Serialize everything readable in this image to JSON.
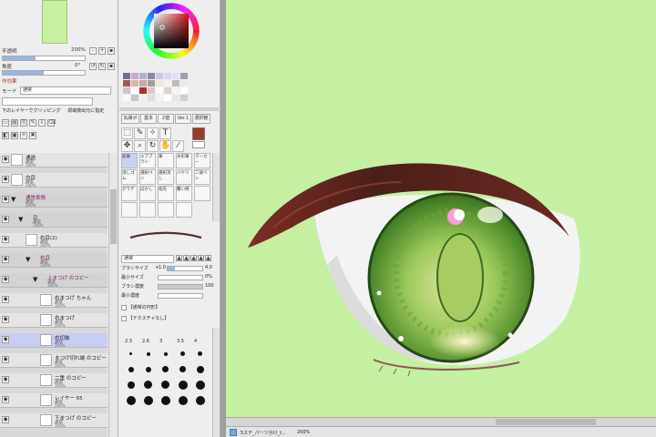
{
  "left_panel": {
    "opacity_label": "不透明",
    "opacity_value": "100%",
    "zoom_value": "200%",
    "rotate_label": "角度",
    "rotate_value": "0°",
    "effects_label": "作効果",
    "texture_label": "テクスチャ",
    "mode_label": "モード",
    "mode_value": "通常",
    "clip_label": "下のレイヤーでクリッピング",
    "select_label": "領域検出元に指定"
  },
  "layers": [
    {
      "name": "通過",
      "mode": "通常",
      "opacity": "100%",
      "type": "layer",
      "indent": 0
    },
    {
      "name": "白目",
      "mode": "通常",
      "opacity": "100%",
      "type": "layer",
      "indent": 0
    },
    {
      "name": "通常表情",
      "mode": "通常",
      "opacity": "100%",
      "type": "group",
      "indent": 0
    },
    {
      "name": "目",
      "mode": "通常",
      "opacity": "100%",
      "type": "group",
      "indent": 1
    },
    {
      "name": "右目(2)",
      "mode": "通常",
      "opacity": "100%",
      "type": "layer",
      "indent": 2
    },
    {
      "name": "右目",
      "mode": "通常",
      "opacity": "100%",
      "type": "group",
      "indent": 2
    },
    {
      "name": "上まつげ のコピー",
      "mode": "通常",
      "opacity": "100%",
      "type": "group",
      "indent": 3
    },
    {
      "name": "右まつげ ちゃん",
      "mode": "通常",
      "opacity": "100%",
      "type": "layer",
      "indent": 4
    },
    {
      "name": "右まつげ",
      "mode": "通常",
      "opacity": "100%",
      "type": "layer",
      "indent": 4
    },
    {
      "name": "右切抜",
      "mode": "通常",
      "opacity": "100%",
      "type": "layer",
      "indent": 4,
      "selected": true
    },
    {
      "name": "まつげ切れ端 のコピー",
      "mode": "通常",
      "opacity": "100%",
      "type": "layer",
      "indent": 4
    },
    {
      "name": "二重 のコピー",
      "mode": "通常",
      "opacity": "100%",
      "type": "layer",
      "indent": 4
    },
    {
      "name": "レイヤー 65",
      "mode": "通常",
      "opacity": "100%",
      "type": "layer",
      "indent": 4
    },
    {
      "name": "下まつげ のコピー",
      "mode": "通常",
      "opacity": "100%",
      "type": "layer",
      "indent": 4
    }
  ],
  "tool_panel": {
    "tabs": [
      "矢縁ポ",
      "基本",
      "2値",
      "Ver.1",
      "選択範"
    ],
    "brushes": [
      "鉛筆",
      "エアブラシ",
      "筆",
      "水彩筆",
      "マーカー",
      "消しゴム",
      "選択ペン",
      "選択消し",
      "バケツ",
      "二値ペン",
      "グラデ",
      "ぼかし",
      "指先",
      "覆い焼",
      "",
      "",
      "",
      "",
      ""
    ],
    "blend_label": "通常",
    "brush_size_label": "ブラシサイズ",
    "brush_size_value": "4.0",
    "brush_size_mult": "x1.0",
    "min_size_label": "最小サイズ",
    "min_size_value": "0%",
    "density_label": "ブラシ濃度",
    "density_value": "100",
    "min_density_label": "最小濃度",
    "shape_label": "【通常の円形】",
    "texture_label": "【テクスチャなし】",
    "dot_sizes": [
      "2.3",
      "2.6",
      "3",
      "3.5",
      "4"
    ],
    "colors": {
      "primary": "#9c3a2a",
      "palette": [
        "#7a6a8a",
        "#c9a9c8",
        "#b2b2d2",
        "#8a8aa8",
        "#c7c7e8",
        "#d8d8f0",
        "#e0e0f8",
        "#a59bb6",
        "#9a5a5a",
        "#d7b9a2",
        "#caa9a0",
        "#9e9e9e",
        "#f0e6dc",
        "#f7f0ea",
        "#bdbdbd",
        "#ececec",
        "#c9c9c9",
        "#ffffff",
        "#b03030",
        "#f0c0c0",
        "#ffffff",
        "#e0d0d0",
        "#fff0f0",
        "#ffffff",
        "#f8f8f8",
        "#c8c8c8",
        "#efefef",
        "#dedede",
        "#f4f4f4",
        "#ffffff",
        "#e7e7e7",
        "#d0d0d0"
      ]
    }
  },
  "canvas": {
    "background": "#c5f0a1"
  },
  "status_bar": {
    "file_name": "5ステ_パーツ分け_t...",
    "zoom": "200%"
  }
}
